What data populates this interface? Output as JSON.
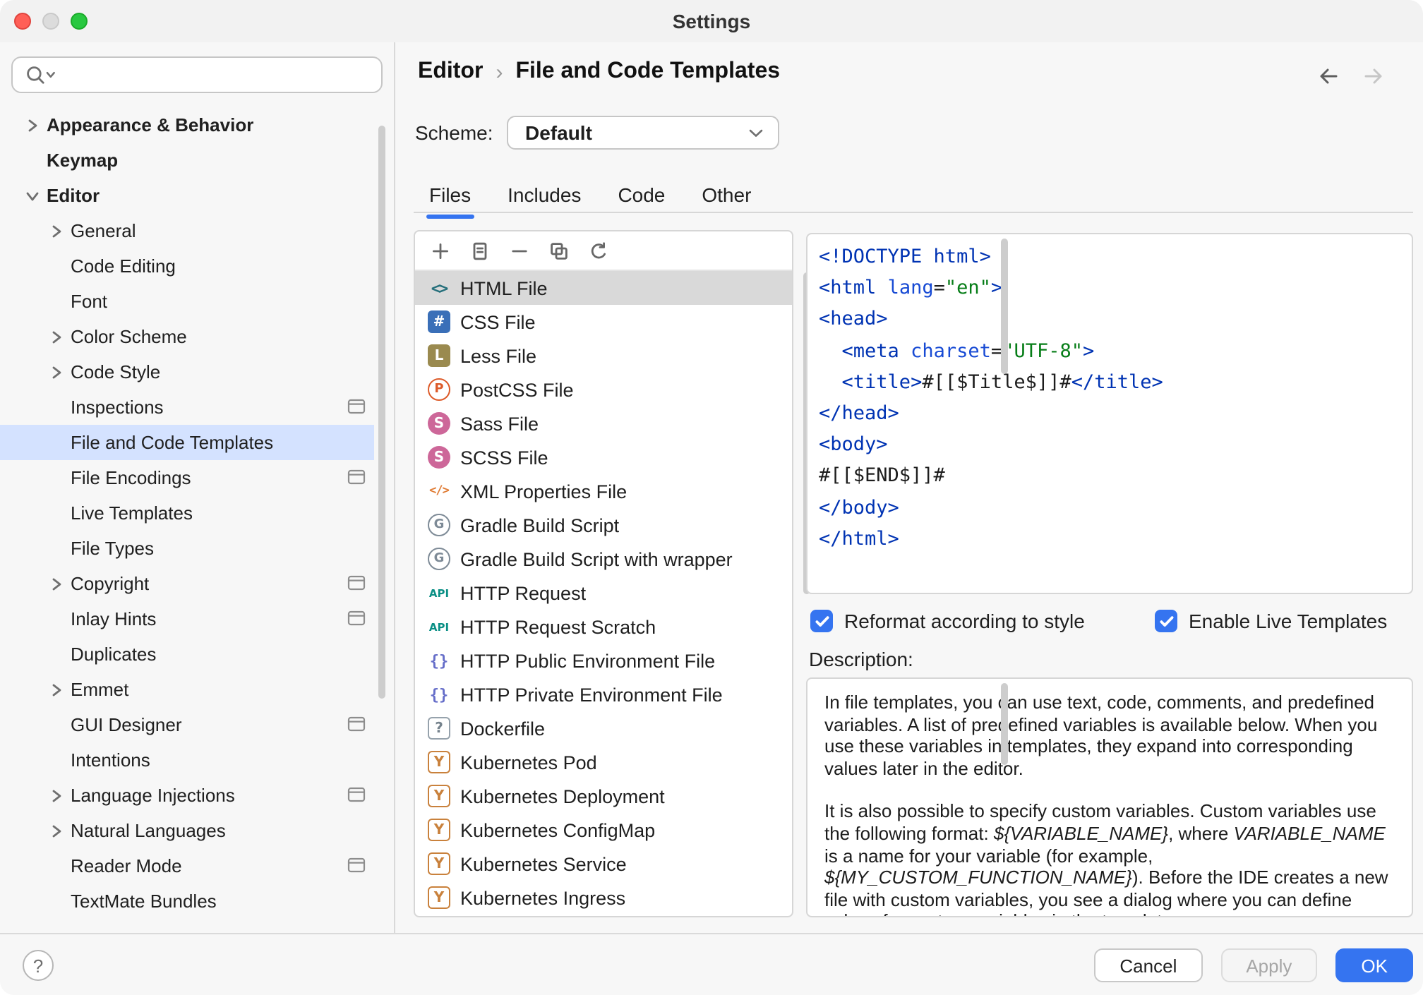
{
  "window": {
    "title": "Settings"
  },
  "header": {
    "breadcrumb": [
      "Editor",
      "File and Code Templates"
    ],
    "separator": "›"
  },
  "sidebar": {
    "items": [
      {
        "label": "Appearance & Behavior",
        "level": 0,
        "bold": true,
        "chevron": "right"
      },
      {
        "label": "Keymap",
        "level": 0,
        "bold": true
      },
      {
        "label": "Editor",
        "level": 0,
        "bold": true,
        "chevron": "down"
      },
      {
        "label": "General",
        "level": 1,
        "chevron": "right"
      },
      {
        "label": "Code Editing",
        "level": 1
      },
      {
        "label": "Font",
        "level": 1
      },
      {
        "label": "Color Scheme",
        "level": 1,
        "chevron": "right"
      },
      {
        "label": "Code Style",
        "level": 1,
        "chevron": "right"
      },
      {
        "label": "Inspections",
        "level": 1,
        "badge": true
      },
      {
        "label": "File and Code Templates",
        "level": 1,
        "selected": true
      },
      {
        "label": "File Encodings",
        "level": 1,
        "badge": true
      },
      {
        "label": "Live Templates",
        "level": 1
      },
      {
        "label": "File Types",
        "level": 1
      },
      {
        "label": "Copyright",
        "level": 1,
        "chevron": "right",
        "badge": true
      },
      {
        "label": "Inlay Hints",
        "level": 1,
        "badge": true
      },
      {
        "label": "Duplicates",
        "level": 1
      },
      {
        "label": "Emmet",
        "level": 1,
        "chevron": "right"
      },
      {
        "label": "GUI Designer",
        "level": 1,
        "badge": true
      },
      {
        "label": "Intentions",
        "level": 1
      },
      {
        "label": "Language Injections",
        "level": 1,
        "chevron": "right",
        "badge": true
      },
      {
        "label": "Natural Languages",
        "level": 1,
        "chevron": "right"
      },
      {
        "label": "Reader Mode",
        "level": 1,
        "badge": true
      },
      {
        "label": "TextMate Bundles",
        "level": 1
      }
    ]
  },
  "scheme": {
    "label": "Scheme:",
    "value": "Default"
  },
  "tabs": [
    {
      "label": "Files",
      "selected": true
    },
    {
      "label": "Includes"
    },
    {
      "label": "Code"
    },
    {
      "label": "Other"
    }
  ],
  "toolbar": {
    "icons": [
      "add",
      "create-from-template",
      "remove",
      "copy",
      "revert"
    ]
  },
  "template_list": [
    {
      "label": "HTML File",
      "icon": "html",
      "selected": true
    },
    {
      "label": "CSS File",
      "icon": "css"
    },
    {
      "label": "Less File",
      "icon": "less"
    },
    {
      "label": "PostCSS File",
      "icon": "postcss"
    },
    {
      "label": "Sass File",
      "icon": "sass"
    },
    {
      "label": "SCSS File",
      "icon": "scss"
    },
    {
      "label": "XML Properties File",
      "icon": "xml"
    },
    {
      "label": "Gradle Build Script",
      "icon": "gradle"
    },
    {
      "label": "Gradle Build Script with wrapper",
      "icon": "gradle"
    },
    {
      "label": "HTTP Request",
      "icon": "api"
    },
    {
      "label": "HTTP Request Scratch",
      "icon": "api"
    },
    {
      "label": "HTTP Public Environment File",
      "icon": "braces"
    },
    {
      "label": "HTTP Private Environment File",
      "icon": "braces"
    },
    {
      "label": "Dockerfile",
      "icon": "docker"
    },
    {
      "label": "Kubernetes Pod",
      "icon": "yaml"
    },
    {
      "label": "Kubernetes Deployment",
      "icon": "yaml"
    },
    {
      "label": "Kubernetes ConfigMap",
      "icon": "yaml"
    },
    {
      "label": "Kubernetes Service",
      "icon": "yaml"
    },
    {
      "label": "Kubernetes Ingress",
      "icon": "yaml"
    }
  ],
  "editor": {
    "code": [
      [
        {
          "s": "tag",
          "t": "<!DOCTYPE html>"
        }
      ],
      [
        {
          "s": "tag",
          "t": "<html "
        },
        {
          "s": "attr",
          "t": "lang"
        },
        {
          "s": "pln",
          "t": "="
        },
        {
          "s": "str",
          "t": "\"en\""
        },
        {
          "s": "tag",
          "t": ">"
        }
      ],
      [
        {
          "s": "tag",
          "t": "<head>"
        }
      ],
      [
        {
          "s": "pln",
          "t": "  "
        },
        {
          "s": "tag",
          "t": "<meta "
        },
        {
          "s": "attr",
          "t": "charset"
        },
        {
          "s": "pln",
          "t": "="
        },
        {
          "s": "str",
          "t": "\"UTF-8\""
        },
        {
          "s": "tag",
          "t": ">"
        }
      ],
      [
        {
          "s": "pln",
          "t": "  "
        },
        {
          "s": "tag",
          "t": "<title>"
        },
        {
          "s": "pln",
          "t": "#[[$Title$]]#"
        },
        {
          "s": "tag",
          "t": "</title>"
        }
      ],
      [
        {
          "s": "tag",
          "t": "</head>"
        }
      ],
      [
        {
          "s": "tag",
          "t": "<body>"
        }
      ],
      [
        {
          "s": "pln",
          "t": "#[[$END$]]#"
        }
      ],
      [
        {
          "s": "tag",
          "t": "</body>"
        }
      ],
      [
        {
          "s": "tag",
          "t": "</html>"
        }
      ]
    ]
  },
  "options": {
    "reformat": {
      "label": "Reformat according to style",
      "checked": true
    },
    "live_templates": {
      "label": "Enable Live Templates",
      "checked": true
    }
  },
  "description": {
    "label": "Description:",
    "paragraphs": [
      [
        {
          "t": "In file templates, you can use text, code, comments, and predefined variables. A list of predefined variables is available below. When you use these variables in templates, they expand into corresponding values later in the editor."
        }
      ],
      [
        {
          "t": "It is also possible to specify custom variables. Custom variables use the following format: "
        },
        {
          "t": "${VARIABLE_NAME}",
          "i": true
        },
        {
          "t": ", where "
        },
        {
          "t": "VARIABLE_NAME",
          "i": true
        },
        {
          "t": " is a name for your variable (for example, "
        },
        {
          "t": "${MY_CUSTOM_FUNCTION_NAME}",
          "i": true
        },
        {
          "t": "). Before the IDE creates a new file with custom variables, you see a dialog where you can define values for custom variables in the template."
        }
      ]
    ]
  },
  "footer": {
    "help": "?",
    "cancel": "Cancel",
    "apply": "Apply",
    "ok": "OK"
  }
}
